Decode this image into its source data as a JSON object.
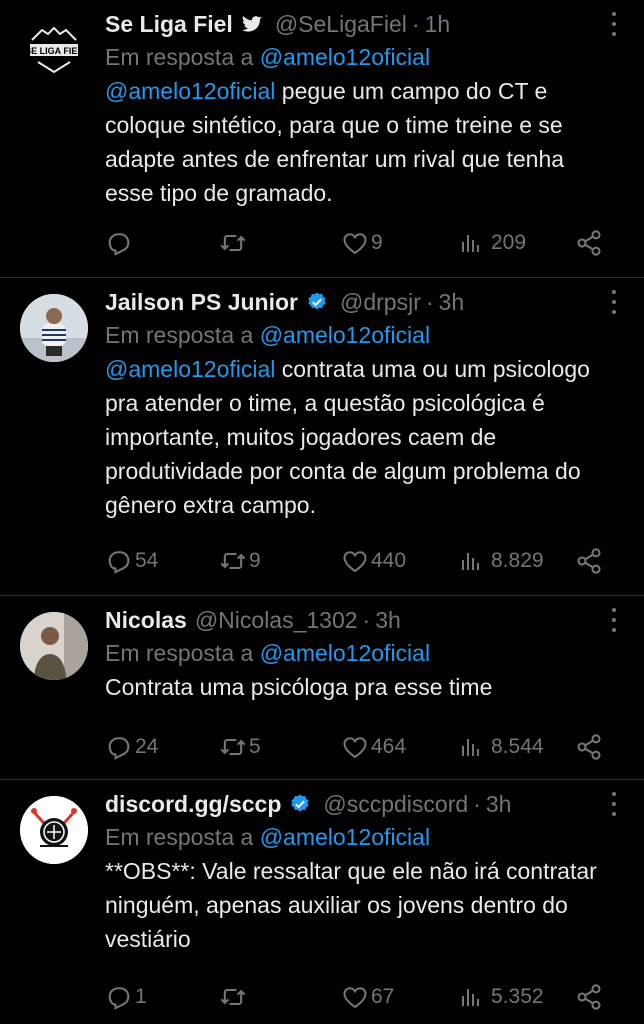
{
  "common": {
    "reply_prefix": "Em resposta a",
    "dot": "·"
  },
  "tweets": [
    {
      "name": "Se Liga Fiel",
      "badge": "bird-icon",
      "handle": "@SeLigaFiel",
      "time": "1h",
      "reply_to": "@amelo12oficial",
      "mention": "@amelo12oficial",
      "text": " pegue um campo do CT e coloque sintético, para que o time treine e se adapte antes de enfrentar um rival que tenha esse tipo de gramado.",
      "avatar_text": "SE LIGA FIEL",
      "replies": "",
      "retweets": "",
      "likes": "9",
      "views": "209"
    },
    {
      "name": "Jailson PS Junior",
      "badge": "verified-badge-icon",
      "handle": "@drpsjr",
      "time": "3h",
      "reply_to": "@amelo12oficial",
      "mention": "@amelo12oficial",
      "text": " contrata uma ou um psicologo pra atender o time, a questão psicológica é importante, muitos jogadores caem de produtividade por conta de algum problema do gênero extra campo.",
      "replies": "54",
      "retweets": "9",
      "likes": "440",
      "views": "8.829"
    },
    {
      "name": "Nicolas",
      "handle": "@Nicolas_1302",
      "time": "3h",
      "reply_to": "@amelo12oficial",
      "mention": "",
      "text": "Contrata uma psicóloga pra esse time",
      "replies": "24",
      "retweets": "5",
      "likes": "464",
      "views": "8.544"
    },
    {
      "name": "discord.gg/sccp",
      "badge": "verified-badge-icon",
      "handle": "@sccpdiscord",
      "time": "3h",
      "reply_to": "@amelo12oficial",
      "mention": "",
      "text": "**OBS**: Vale ressaltar que ele não irá contratar ninguém, apenas auxiliar os jovens dentro do vestiário",
      "replies": "1",
      "retweets": "",
      "likes": "67",
      "views": "5.352"
    }
  ],
  "colors": {
    "background": "#000000",
    "text": "#e7e9ea",
    "muted": "#71767b",
    "link": "#1d9bf0",
    "verified": "#1d9bf0"
  }
}
